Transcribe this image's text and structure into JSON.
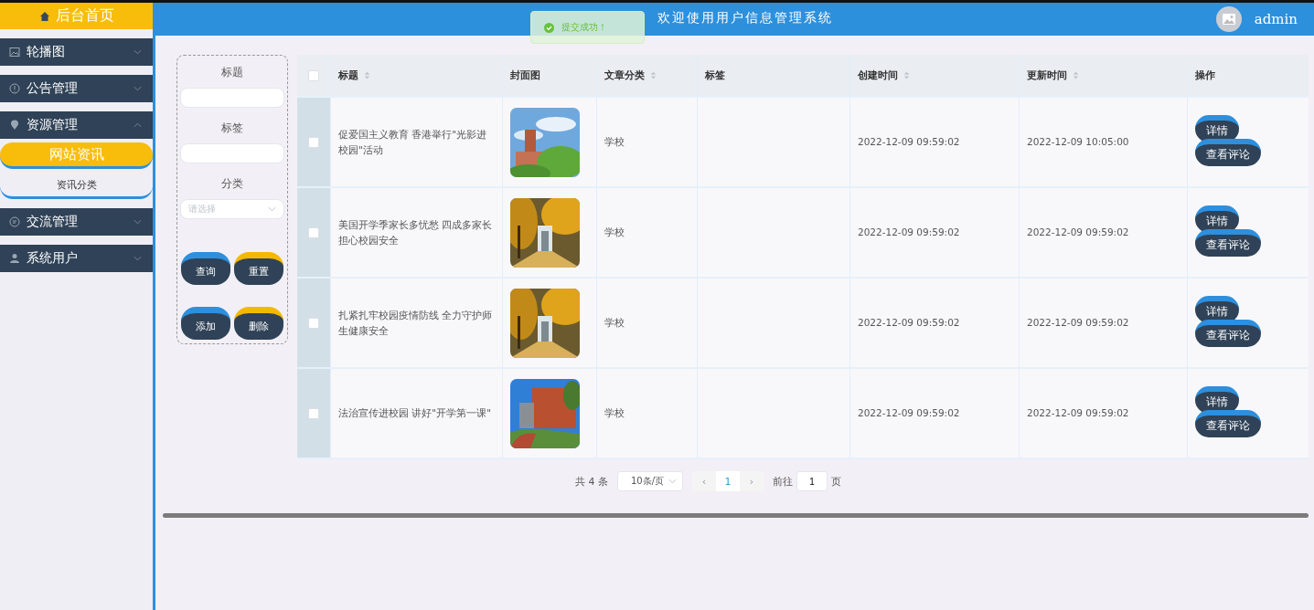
{
  "sidebar": {
    "home": "后台首页",
    "menus": [
      {
        "label": "轮播图",
        "expanded": false
      },
      {
        "label": "公告管理",
        "expanded": false
      },
      {
        "label": "资源管理",
        "expanded": true,
        "children": [
          {
            "label": "网站资讯",
            "selected": true
          },
          {
            "label": "资讯分类",
            "selected": false
          }
        ]
      },
      {
        "label": "交流管理",
        "expanded": false
      },
      {
        "label": "系统用户",
        "expanded": false
      }
    ]
  },
  "header": {
    "title": "欢迎使用用户信息管理系统",
    "user": "admin"
  },
  "toast": {
    "message": "提交成功！"
  },
  "search": {
    "fields": [
      {
        "kind": "input",
        "label": "标题"
      },
      {
        "kind": "input",
        "label": "标签"
      },
      {
        "kind": "select",
        "label": "分类",
        "placeholder": "请选择"
      }
    ],
    "buttons": [
      {
        "label": "查询",
        "color": "#2d8fdd"
      },
      {
        "label": "重置",
        "color": "#f5b800"
      },
      {
        "label": "添加",
        "color": "#2d8fdd"
      },
      {
        "label": "删除",
        "color": "#f5b800"
      }
    ]
  },
  "table": {
    "all_checked": false,
    "columns": [
      {
        "label": "标题",
        "sortable": true
      },
      {
        "label": "封面图",
        "sortable": false
      },
      {
        "label": "文章分类",
        "sortable": true
      },
      {
        "label": "标签",
        "sortable": false
      },
      {
        "label": "创建时间",
        "sortable": true
      },
      {
        "label": "更新时间",
        "sortable": true
      },
      {
        "label": "操作",
        "sortable": false
      }
    ],
    "rows": [
      {
        "checked": false,
        "title": "促爱国主义教育 香港举行\"光影进校园\"活动",
        "cover": {
          "kind": "picture"
        },
        "category": "学校",
        "created": "2022-12-09 09:59:02",
        "updated": "2022-12-09 10:05:00",
        "actions": [
          "详情",
          "查看评论"
        ]
      },
      {
        "checked": false,
        "title": "美国开学季家长多忧愁 四成多家长担心校园安全",
        "cover": {
          "kind": "picture"
        },
        "category": "学校",
        "created": "2022-12-09 09:59:02",
        "updated": "2022-12-09 09:59:02",
        "actions": [
          "详情",
          "查看评论"
        ]
      },
      {
        "checked": false,
        "title": "扎紧扎牢校园疫情防线 全力守护师生健康安全",
        "cover": {
          "kind": "picture"
        },
        "category": "学校",
        "created": "2022-12-09 09:59:02",
        "updated": "2022-12-09 09:59:02",
        "actions": [
          "详情",
          "查看评论"
        ]
      },
      {
        "checked": false,
        "title": "法治宣传进校园 讲好\"开学第一课\"",
        "cover": {
          "kind": "picture"
        },
        "category": "学校",
        "created": "2022-12-09 09:59:02",
        "updated": "2022-12-09 09:59:02",
        "actions": [
          "详情",
          "查看评论"
        ]
      }
    ]
  },
  "pagination": {
    "total": "共 4 条",
    "page_size": "10条/页",
    "prev": "‹",
    "pages": [
      {
        "label": "1",
        "selected": true
      }
    ],
    "next": "›",
    "goto": "前往",
    "goto_value": "1",
    "goto_suffix": "页"
  }
}
